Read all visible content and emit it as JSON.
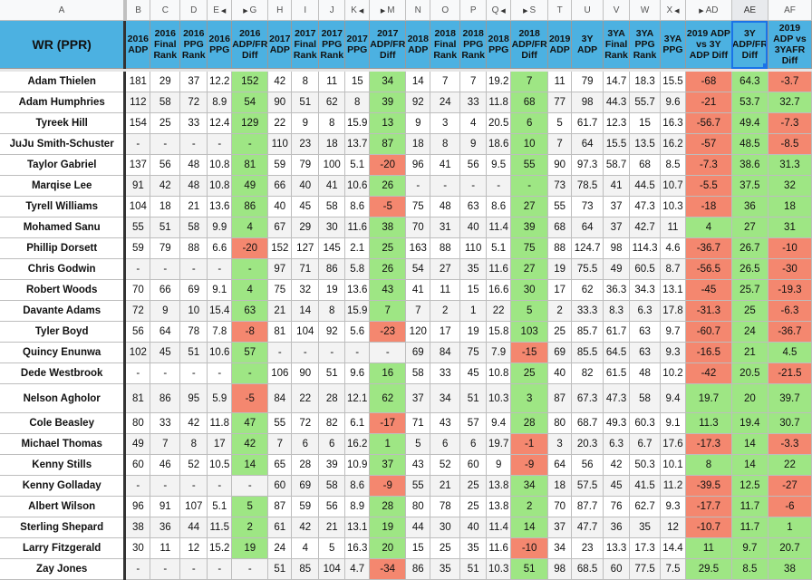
{
  "column_letters": [
    "A",
    "B",
    "C",
    "D",
    "E",
    "G",
    "H",
    "I",
    "J",
    "K",
    "M",
    "N",
    "O",
    "P",
    "Q",
    "S",
    "T",
    "U",
    "V",
    "W",
    "X",
    "AD",
    "AE",
    "AF"
  ],
  "selected_column": "AE",
  "headers": [
    "WR (PPR)",
    "2016 ADP",
    "2016 Final Rank",
    "2016 PPG Rank",
    "2016 PPG",
    "2016 ADP/FR Diff",
    "2017 ADP",
    "2017 Final Rank",
    "2017 PPG Rank",
    "2017 PPG",
    "2017 ADP/FR Diff",
    "2018 ADP",
    "2018 Final Rank",
    "2018 PPG Rank",
    "2018 PPG",
    "2018 ADP/FR Diff",
    "2019 ADP",
    "3Y ADP",
    "3YA Final Rank",
    "3YA PPG Rank",
    "3YA PPG",
    "2019 ADP vs 3Y ADP Diff",
    "3Y ADP/FR Diff",
    "2019 ADP vs 3YAFR Diff"
  ],
  "colors": {
    "header_blue": "#4cb1e1",
    "positive_green": "#9ee684",
    "negative_red": "#f4876f",
    "selection_blue": "#1a73e8"
  },
  "rows": [
    {
      "name": "Adam Thielen",
      "values": [
        "181",
        "29",
        "37",
        "12.2",
        "152",
        "42",
        "8",
        "11",
        "15",
        "34",
        "14",
        "7",
        "7",
        "19.2",
        "7",
        "11",
        "79",
        "14.7",
        "18.3",
        "15.5",
        "-68",
        "64.3",
        "-3.7"
      ]
    },
    {
      "name": "Adam Humphries",
      "values": [
        "112",
        "58",
        "72",
        "8.9",
        "54",
        "90",
        "51",
        "62",
        "8",
        "39",
        "92",
        "24",
        "33",
        "11.8",
        "68",
        "77",
        "98",
        "44.3",
        "55.7",
        "9.6",
        "-21",
        "53.7",
        "32.7"
      ]
    },
    {
      "name": "Tyreek Hill",
      "values": [
        "154",
        "25",
        "33",
        "12.4",
        "129",
        "22",
        "9",
        "8",
        "15.9",
        "13",
        "9",
        "3",
        "4",
        "20.5",
        "6",
        "5",
        "61.7",
        "12.3",
        "15",
        "16.3",
        "-56.7",
        "49.4",
        "-7.3"
      ]
    },
    {
      "name": "JuJu Smith-Schuster",
      "values": [
        "-",
        "-",
        "-",
        "-",
        "-",
        "110",
        "23",
        "18",
        "13.7",
        "87",
        "18",
        "8",
        "9",
        "18.6",
        "10",
        "7",
        "64",
        "15.5",
        "13.5",
        "16.2",
        "-57",
        "48.5",
        "-8.5"
      ]
    },
    {
      "name": "Taylor Gabriel",
      "values": [
        "137",
        "56",
        "48",
        "10.8",
        "81",
        "59",
        "79",
        "100",
        "5.1",
        "-20",
        "96",
        "41",
        "56",
        "9.5",
        "55",
        "90",
        "97.3",
        "58.7",
        "68",
        "8.5",
        "-7.3",
        "38.6",
        "31.3"
      ]
    },
    {
      "name": "Marqise Lee",
      "values": [
        "91",
        "42",
        "48",
        "10.8",
        "49",
        "66",
        "40",
        "41",
        "10.6",
        "26",
        "-",
        "-",
        "-",
        "-",
        "-",
        "73",
        "78.5",
        "41",
        "44.5",
        "10.7",
        "-5.5",
        "37.5",
        "32"
      ]
    },
    {
      "name": "Tyrell Williams",
      "values": [
        "104",
        "18",
        "21",
        "13.6",
        "86",
        "40",
        "45",
        "58",
        "8.6",
        "-5",
        "75",
        "48",
        "63",
        "8.6",
        "27",
        "55",
        "73",
        "37",
        "47.3",
        "10.3",
        "-18",
        "36",
        "18"
      ]
    },
    {
      "name": "Mohamed Sanu",
      "values": [
        "55",
        "51",
        "58",
        "9.9",
        "4",
        "67",
        "29",
        "30",
        "11.6",
        "38",
        "70",
        "31",
        "40",
        "11.4",
        "39",
        "68",
        "64",
        "37",
        "42.7",
        "11",
        "4",
        "27",
        "31"
      ]
    },
    {
      "name": "Phillip Dorsett",
      "values": [
        "59",
        "79",
        "88",
        "6.6",
        "-20",
        "152",
        "127",
        "145",
        "2.1",
        "25",
        "163",
        "88",
        "110",
        "5.1",
        "75",
        "88",
        "124.7",
        "98",
        "114.3",
        "4.6",
        "-36.7",
        "26.7",
        "-10"
      ]
    },
    {
      "name": "Chris Godwin",
      "values": [
        "-",
        "-",
        "-",
        "-",
        "-",
        "97",
        "71",
        "86",
        "5.8",
        "26",
        "54",
        "27",
        "35",
        "11.6",
        "27",
        "19",
        "75.5",
        "49",
        "60.5",
        "8.7",
        "-56.5",
        "26.5",
        "-30"
      ]
    },
    {
      "name": "Robert Woods",
      "values": [
        "70",
        "66",
        "69",
        "9.1",
        "4",
        "75",
        "32",
        "19",
        "13.6",
        "43",
        "41",
        "11",
        "15",
        "16.6",
        "30",
        "17",
        "62",
        "36.3",
        "34.3",
        "13.1",
        "-45",
        "25.7",
        "-19.3"
      ]
    },
    {
      "name": "Davante Adams",
      "values": [
        "72",
        "9",
        "10",
        "15.4",
        "63",
        "21",
        "14",
        "8",
        "15.9",
        "7",
        "7",
        "2",
        "1",
        "22",
        "5",
        "2",
        "33.3",
        "8.3",
        "6.3",
        "17.8",
        "-31.3",
        "25",
        "-6.3"
      ]
    },
    {
      "name": "Tyler Boyd",
      "values": [
        "56",
        "64",
        "78",
        "7.8",
        "-8",
        "81",
        "104",
        "92",
        "5.6",
        "-23",
        "120",
        "17",
        "19",
        "15.8",
        "103",
        "25",
        "85.7",
        "61.7",
        "63",
        "9.7",
        "-60.7",
        "24",
        "-36.7"
      ]
    },
    {
      "name": "Quincy Enunwa",
      "values": [
        "102",
        "45",
        "51",
        "10.6",
        "57",
        "-",
        "-",
        "-",
        "-",
        "-",
        "69",
        "84",
        "75",
        "7.9",
        "-15",
        "69",
        "85.5",
        "64.5",
        "63",
        "9.3",
        "-16.5",
        "21",
        "4.5"
      ]
    },
    {
      "name": "Dede Westbrook",
      "values": [
        "-",
        "-",
        "-",
        "-",
        "-",
        "106",
        "90",
        "51",
        "9.6",
        "16",
        "58",
        "33",
        "45",
        "10.8",
        "25",
        "40",
        "82",
        "61.5",
        "48",
        "10.2",
        "-42",
        "20.5",
        "-21.5"
      ]
    },
    {
      "name": "Nelson Agholor",
      "values": [
        "81",
        "86",
        "95",
        "5.9",
        "-5",
        "84",
        "22",
        "28",
        "12.1",
        "62",
        "37",
        "34",
        "51",
        "10.3",
        "3",
        "87",
        "67.3",
        "47.3",
        "58",
        "9.4",
        "19.7",
        "20",
        "39.7"
      ]
    },
    {
      "name": "Cole Beasley",
      "values": [
        "80",
        "33",
        "42",
        "11.8",
        "47",
        "55",
        "72",
        "82",
        "6.1",
        "-17",
        "71",
        "43",
        "57",
        "9.4",
        "28",
        "80",
        "68.7",
        "49.3",
        "60.3",
        "9.1",
        "11.3",
        "19.4",
        "30.7"
      ]
    },
    {
      "name": "Michael Thomas",
      "values": [
        "49",
        "7",
        "8",
        "17",
        "42",
        "7",
        "6",
        "6",
        "16.2",
        "1",
        "5",
        "6",
        "6",
        "19.7",
        "-1",
        "3",
        "20.3",
        "6.3",
        "6.7",
        "17.6",
        "-17.3",
        "14",
        "-3.3"
      ]
    },
    {
      "name": "Kenny Stills",
      "values": [
        "60",
        "46",
        "52",
        "10.5",
        "14",
        "65",
        "28",
        "39",
        "10.9",
        "37",
        "43",
        "52",
        "60",
        "9",
        "-9",
        "64",
        "56",
        "42",
        "50.3",
        "10.1",
        "8",
        "14",
        "22"
      ]
    },
    {
      "name": "Kenny Golladay",
      "values": [
        "-",
        "-",
        "-",
        "-",
        "-",
        "60",
        "69",
        "58",
        "8.6",
        "-9",
        "55",
        "21",
        "25",
        "13.8",
        "34",
        "18",
        "57.5",
        "45",
        "41.5",
        "11.2",
        "-39.5",
        "12.5",
        "-27"
      ]
    },
    {
      "name": "Albert Wilson",
      "values": [
        "96",
        "91",
        "107",
        "5.1",
        "5",
        "87",
        "59",
        "56",
        "8.9",
        "28",
        "80",
        "78",
        "25",
        "13.8",
        "2",
        "70",
        "87.7",
        "76",
        "62.7",
        "9.3",
        "-17.7",
        "11.7",
        "-6"
      ]
    },
    {
      "name": "Sterling Shepard",
      "values": [
        "38",
        "36",
        "44",
        "11.5",
        "2",
        "61",
        "42",
        "21",
        "13.1",
        "19",
        "44",
        "30",
        "40",
        "11.4",
        "14",
        "37",
        "47.7",
        "36",
        "35",
        "12",
        "-10.7",
        "11.7",
        "1"
      ]
    },
    {
      "name": "Larry Fitzgerald",
      "values": [
        "30",
        "11",
        "12",
        "15.2",
        "19",
        "24",
        "4",
        "5",
        "16.3",
        "20",
        "15",
        "25",
        "35",
        "11.6",
        "-10",
        "34",
        "23",
        "13.3",
        "17.3",
        "14.4",
        "11",
        "9.7",
        "20.7"
      ]
    },
    {
      "name": "Zay Jones",
      "values": [
        "-",
        "-",
        "-",
        "-",
        "-",
        "51",
        "85",
        "104",
        "4.7",
        "-34",
        "86",
        "35",
        "51",
        "10.3",
        "51",
        "98",
        "68.5",
        "60",
        "77.5",
        "7.5",
        "29.5",
        "8.5",
        "38"
      ]
    }
  ]
}
